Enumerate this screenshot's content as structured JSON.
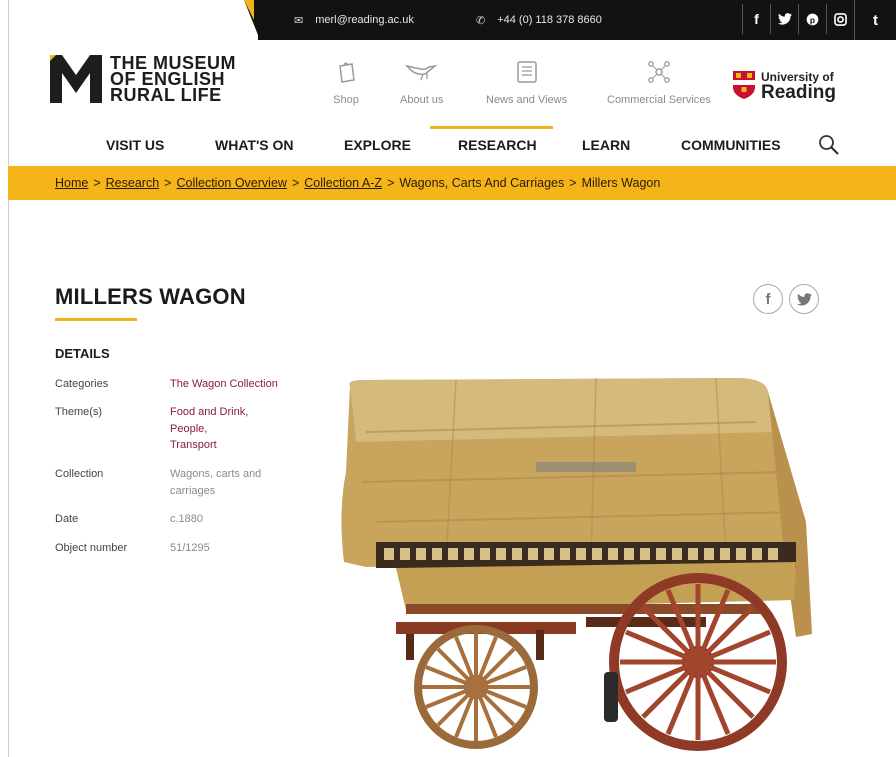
{
  "topbar": {
    "email": "merl@reading.ac.uk",
    "phone": "+44 (0) 118 378 8660",
    "social": [
      "f",
      "t",
      "p",
      "i",
      "t"
    ]
  },
  "logo": {
    "line1": "THE MUSEUM",
    "line2": "OF ENGLISH",
    "line3": "RURAL LIFE"
  },
  "header_nav": [
    {
      "label": "Shop",
      "icon": "bag-icon"
    },
    {
      "label": "About us",
      "icon": "bird-icon"
    },
    {
      "label": "News and Views",
      "icon": "newspaper-icon"
    },
    {
      "label": "Commercial Services",
      "icon": "network-icon"
    }
  ],
  "university": {
    "line1": "University of",
    "line2": "Reading"
  },
  "main_nav": [
    "VISIT US",
    "WHAT'S ON",
    "EXPLORE",
    "RESEARCH",
    "LEARN",
    "COMMUNITIES"
  ],
  "active_nav": "RESEARCH",
  "breadcrumb": {
    "links": [
      "Home",
      "Research",
      "Collection Overview",
      "Collection A-Z"
    ],
    "plain": [
      "Wagons, Carts And Carriages",
      "Millers Wagon"
    ],
    "separator": ">"
  },
  "page": {
    "title": "MILLERS WAGON",
    "details_heading": "DETAILS",
    "details": {
      "categories_label": "Categories",
      "categories_value": "The Wagon Collection",
      "themes_label": "Theme(s)",
      "themes_values": [
        "Food and Drink,",
        "People,",
        "Transport"
      ],
      "collection_label": "Collection",
      "collection_value_1": "Wagons, carts and",
      "collection_value_2": "carriages",
      "date_label": "Date",
      "date_value": "c.1880",
      "object_number_label": "Object number",
      "object_number_value": "51/1295"
    }
  },
  "colors": {
    "accent": "#f1b51c",
    "link": "#8b1c3b",
    "topbar": "#121212"
  }
}
